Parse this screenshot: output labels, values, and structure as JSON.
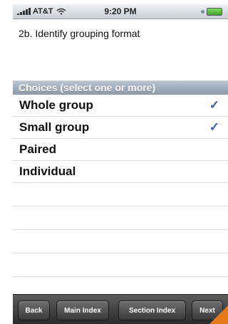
{
  "status_bar": {
    "carrier": "AT&T",
    "time": "9:20 PM"
  },
  "question": {
    "text": "2b. Identify grouping format"
  },
  "choices": {
    "header": "Choices (select one or more)",
    "items": [
      {
        "label": "Whole group",
        "checked": "✓"
      },
      {
        "label": "Small group",
        "checked": "✓"
      },
      {
        "label": "Paired",
        "checked": ""
      },
      {
        "label": "Individual",
        "checked": ""
      }
    ]
  },
  "toolbar": {
    "back": "Back",
    "main_index": "Main Index",
    "section_index": "Section Index",
    "next": "Next"
  },
  "colors": {
    "check": "#3d5fa8",
    "page_curl": "#e77817",
    "toolbar": "#3a3a3a"
  }
}
